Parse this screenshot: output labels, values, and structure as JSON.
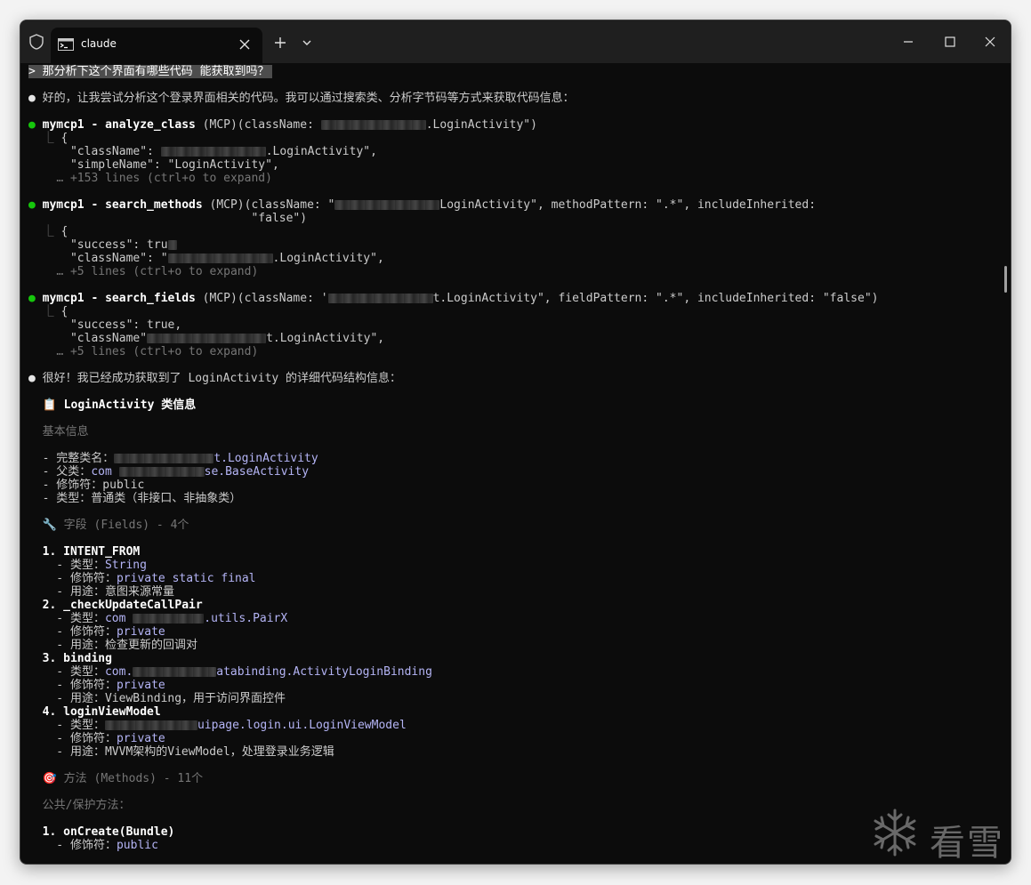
{
  "window": {
    "tab_title": "claude",
    "new_tab_symbol": "+",
    "icons": [
      "shield-icon",
      "terminal-icon",
      "close-icon",
      "plus-icon",
      "chevron-down-icon",
      "minimize-icon",
      "maximize-icon",
      "close-window-icon"
    ]
  },
  "terminal": {
    "prompt": "> 那分析下这个界面有哪些代码 能获取到吗？",
    "intro": "好的，让我尝试分析这个登录界面相关的代码。我可以通过搜索类、分析字节码等方式来获取代码信息：",
    "bullet": "●",
    "elbow": "⎿",
    "call1": {
      "tool": "mymcp1 - analyze_class",
      "args_start": " (MCP)(className: ",
      "args_end": ".LoginActivity\")",
      "out1": "{",
      "out2": "\"className\": ",
      "out2_end": ".LoginActivity\",",
      "out3": "\"simpleName\": \"LoginActivity\",",
      "more": "… +153 lines (ctrl+o to expand)"
    },
    "call2": {
      "tool": "mymcp1 - search_methods",
      "args_start": " (MCP)(className: \"",
      "args_end": "LoginActivity\", methodPattern: \".*\", includeInherited:",
      "args_cont": "\"false\")",
      "out1": "{",
      "out2": "\"success\": tru",
      "out3": "\"className\": \"",
      "out3_end": ".LoginActivity\",",
      "more": "… +5 lines (ctrl+o to expand)"
    },
    "call3": {
      "tool": "mymcp1 - search_fields",
      "args_start": " (MCP)(className: '",
      "args_end": "t.LoginActivity\", fieldPattern: \".*\", includeInherited: \"false\")",
      "out1": "{",
      "out2": "\"success\": true,",
      "out3": "\"className\"",
      "out3_end": "t.LoginActivity\",",
      "more": "… +5 lines (ctrl+o to expand)"
    },
    "summary": "很好！我已经成功获取到了 LoginActivity 的详细代码结构信息：",
    "class_heading": "📋 LoginActivity 类信息",
    "basic_info": "基本信息",
    "basic": {
      "fullname_label": "- 完整类名：",
      "fullname_value": "t.LoginActivity",
      "parent_label": "- 父类：",
      "parent_prefix": "com",
      "parent_value": "se.BaseActivity",
      "modifier": "- 修饰符：public",
      "type": "- 类型：普通类（非接口、非抽象类）"
    },
    "fields_heading": "🔧 字段 (Fields) - 4个",
    "fields": {
      "f1_name": "1. INTENT_FROM",
      "f1_type_label": "  - 类型：",
      "f1_type": "String",
      "f1_mod_label": "  - 修饰符：",
      "f1_mod": "private static final",
      "f1_use": "  - 用途：意图来源常量",
      "f2_name": "2. _checkUpdateCallPair",
      "f2_type_label": "  - 类型：",
      "f2_type_prefix": "com",
      "f2_type": ".utils.PairX",
      "f2_mod_label": "  - 修饰符：",
      "f2_mod": "private",
      "f2_use": "  - 用途：检查更新的回调对",
      "f3_name": "3. binding",
      "f3_type_label": "  - 类型：",
      "f3_type_prefix": "com.",
      "f3_type": "atabinding.ActivityLoginBinding",
      "f3_mod_label": "  - 修饰符：",
      "f3_mod": "private",
      "f3_use": "  - 用途：ViewBinding，用于访问界面控件",
      "f4_name": "4. loginViewModel",
      "f4_type_label": "  - 类型：",
      "f4_type": "uipage.login.ui.LoginViewModel",
      "f4_mod_label": "  - 修饰符：",
      "f4_mod": "private",
      "f4_use": "  - 用途：MVVM架构的ViewModel，处理登录业务逻辑"
    },
    "methods_heading": "🎯 方法 (Methods) - 11个",
    "public_methods": "公共/保护方法：",
    "m1_name": "1. onCreate(Bundle)",
    "m1_mod_label": "  - 修饰符：",
    "m1_mod": "public"
  },
  "watermark": {
    "text": "看雪",
    "icon": "snowflake-icon"
  }
}
